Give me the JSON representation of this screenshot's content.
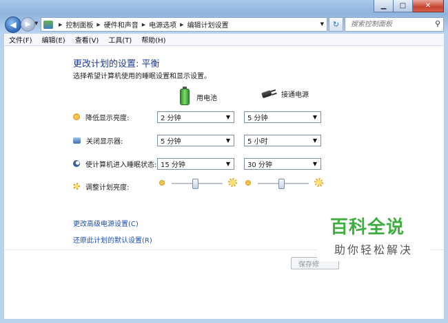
{
  "window": {
    "caption": {
      "minimize": "▁",
      "maximize": "□",
      "close": "✕"
    }
  },
  "address_bar": {
    "crumbs": [
      "控制面板",
      "硬件和声音",
      "电源选项",
      "编辑计划设置"
    ],
    "search_placeholder": "搜索控制面板"
  },
  "menu": [
    "文件(F)",
    "编辑(E)",
    "查看(V)",
    "工具(T)",
    "帮助(H)"
  ],
  "page": {
    "title": "更改计划的设置: 平衡",
    "subtitle": "选择希望计算机使用的睡眠设置和显示设置。",
    "columns": {
      "battery": "用电池",
      "plugged": "接通电源"
    },
    "rows": {
      "dim": {
        "label": "降低显示亮度:",
        "battery": "2 分钟",
        "plugged": "5 分钟"
      },
      "display_off": {
        "label": "关闭显示器:",
        "battery": "5 分钟",
        "plugged": "5 小时"
      },
      "sleep": {
        "label": "使计算机进入睡眠状态:",
        "battery": "15 分钟",
        "plugged": "30 分钟"
      },
      "brightness": {
        "label": "调整计划亮度:",
        "battery_level": 0.45,
        "plugged_level": 0.45
      }
    },
    "links": {
      "advanced": "更改高级电源设置(C)",
      "restore": "还原此计划的默认设置(R)"
    },
    "save_button": "保存修"
  },
  "watermark": {
    "title": "百科全说",
    "subtitle": "助你轻松解决"
  }
}
